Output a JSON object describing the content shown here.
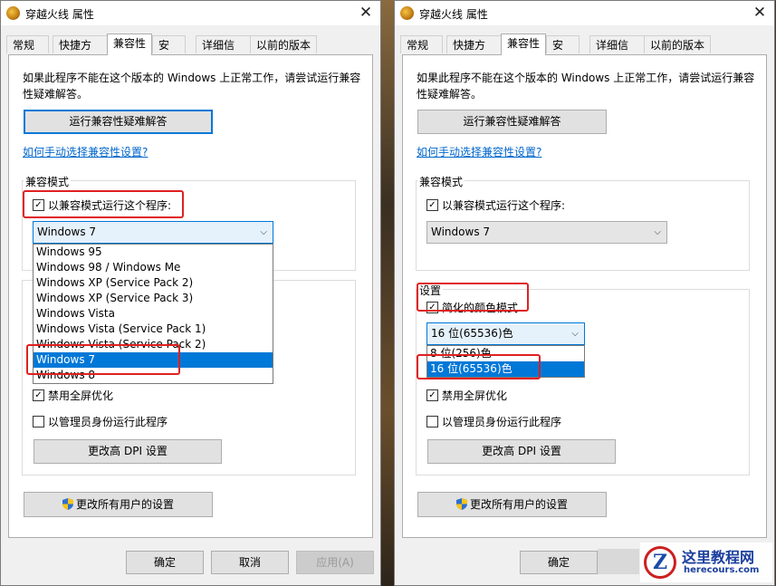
{
  "window": {
    "title": "穿越火线 属性",
    "tabs": [
      "常规",
      "快捷方式",
      "兼容性",
      "安全",
      "详细信息",
      "以前的版本"
    ],
    "active_tab": "兼容性"
  },
  "compat": {
    "description": "如果此程序不能在这个版本的 Windows 上正常工作，请尝试运行兼容性疑难解答。",
    "run_troubleshooter_label": "运行兼容性疑难解答",
    "manual_link": "如何手动选择兼容性设置?",
    "compat_mode_group": "兼容模式",
    "run_in_compat_label": "以兼容模式运行这个程序:",
    "selected_os": "Windows 7",
    "os_options": [
      "Windows 95",
      "Windows 98 / Windows Me",
      "Windows XP (Service Pack 2)",
      "Windows XP (Service Pack 3)",
      "Windows Vista",
      "Windows Vista (Service Pack 1)",
      "Windows Vista (Service Pack 2)",
      "Windows 7",
      "Windows 8"
    ],
    "settings_group": "设置",
    "reduced_color_label": "简化的颜色模式",
    "selected_color": "16 位(65536)色",
    "color_options": [
      "8 位(256)色",
      "16 位(65536)色"
    ],
    "disable_fullscreen_label": "禁用全屏优化",
    "run_as_admin_label": "以管理员身份运行此程序",
    "change_dpi_label": "更改高 DPI 设置",
    "change_all_users_label": "更改所有用户的设置"
  },
  "footer": {
    "ok": "确定",
    "cancel": "取消",
    "apply": "应用(A)"
  },
  "watermark": {
    "title": "这里教程网",
    "url": "herecours.com",
    "logo": "Z"
  },
  "colors": {
    "accent": "#0078d7",
    "highlight_box": "#e02020"
  }
}
